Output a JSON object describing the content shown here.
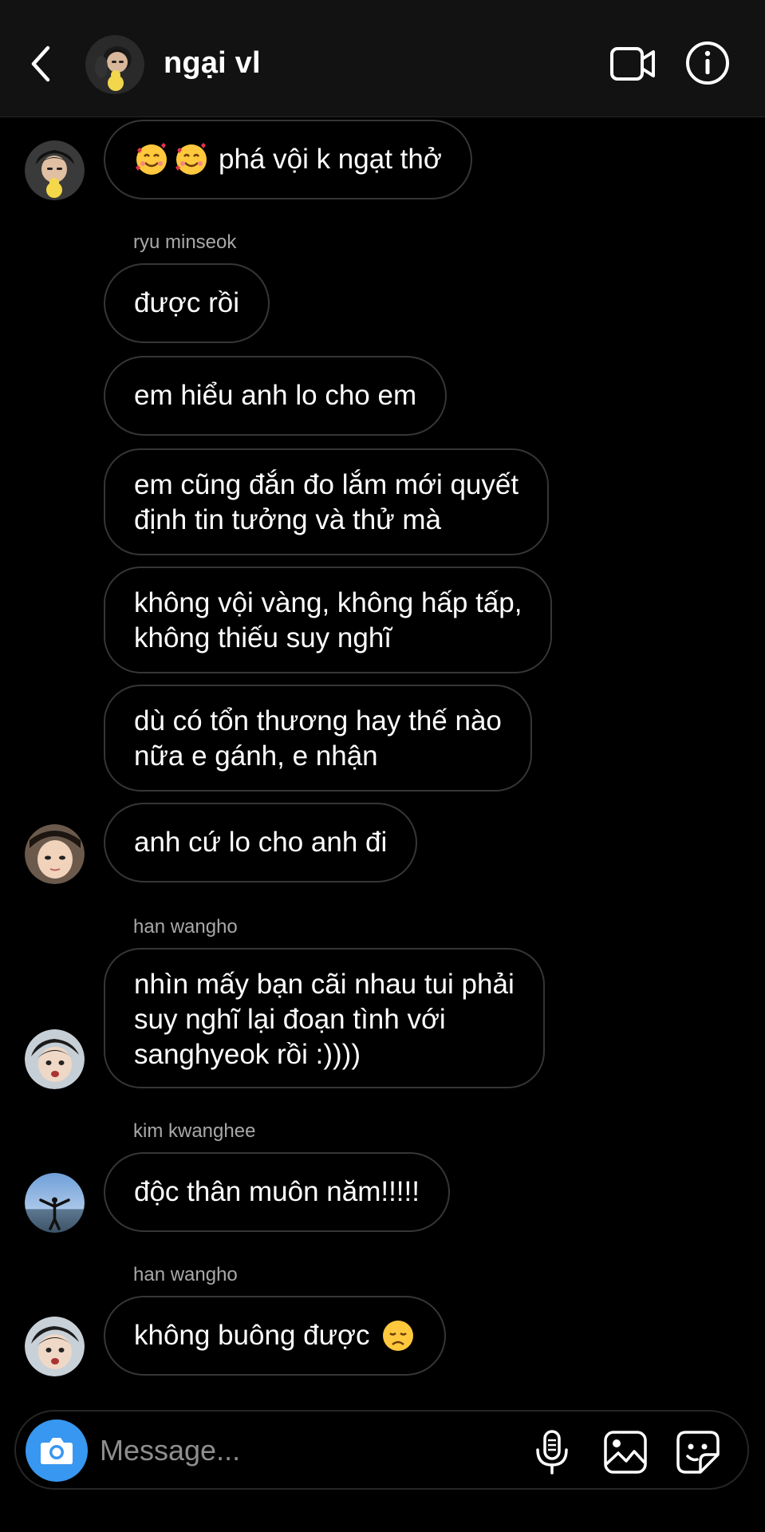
{
  "header": {
    "title": "ngại vl",
    "back_icon": "chevron-left-icon",
    "video_icon": "video-call-icon",
    "info_icon": "info-icon"
  },
  "messages": [
    {
      "text": "phá vội k ngạt thở",
      "emoji": [
        "smiling-face-with-hearts",
        "smiling-face-with-hearts"
      ]
    },
    {
      "sender": "ryu minseok",
      "text": "được rồi"
    },
    {
      "text": "em hiểu anh lo cho em"
    },
    {
      "lines": [
        "em cũng đắn đo lắm mới quyết",
        "định tin tưởng và thử mà"
      ]
    },
    {
      "lines": [
        "không vội vàng, không hấp tấp,",
        "không thiếu suy nghĩ"
      ]
    },
    {
      "lines": [
        "dù có tổn thương hay thế nào",
        "nữa e gánh, e nhận"
      ]
    },
    {
      "text": "anh cứ lo cho anh đi"
    },
    {
      "sender": "han wangho",
      "lines": [
        "nhìn mấy bạn cãi nhau tui phải",
        "suy nghĩ lại đoạn tình với",
        "sanghyeok rồi :))))"
      ]
    },
    {
      "sender": "kim kwanghee",
      "text": "độc thân muôn năm!!!!!"
    },
    {
      "sender": "han wangho",
      "text": "không buông được",
      "emoji_after": "disappointed-face"
    }
  ],
  "composer": {
    "placeholder": "Message...",
    "camera_icon": "camera-icon",
    "mic_icon": "microphone-icon",
    "gallery_icon": "gallery-icon",
    "sticker_icon": "sticker-icon"
  },
  "colors": {
    "background": "#000000",
    "header_bg": "#121212",
    "bubble_border": "#363636",
    "camera_button": "#3897f0",
    "secondary_text": "#a8a8a8"
  }
}
